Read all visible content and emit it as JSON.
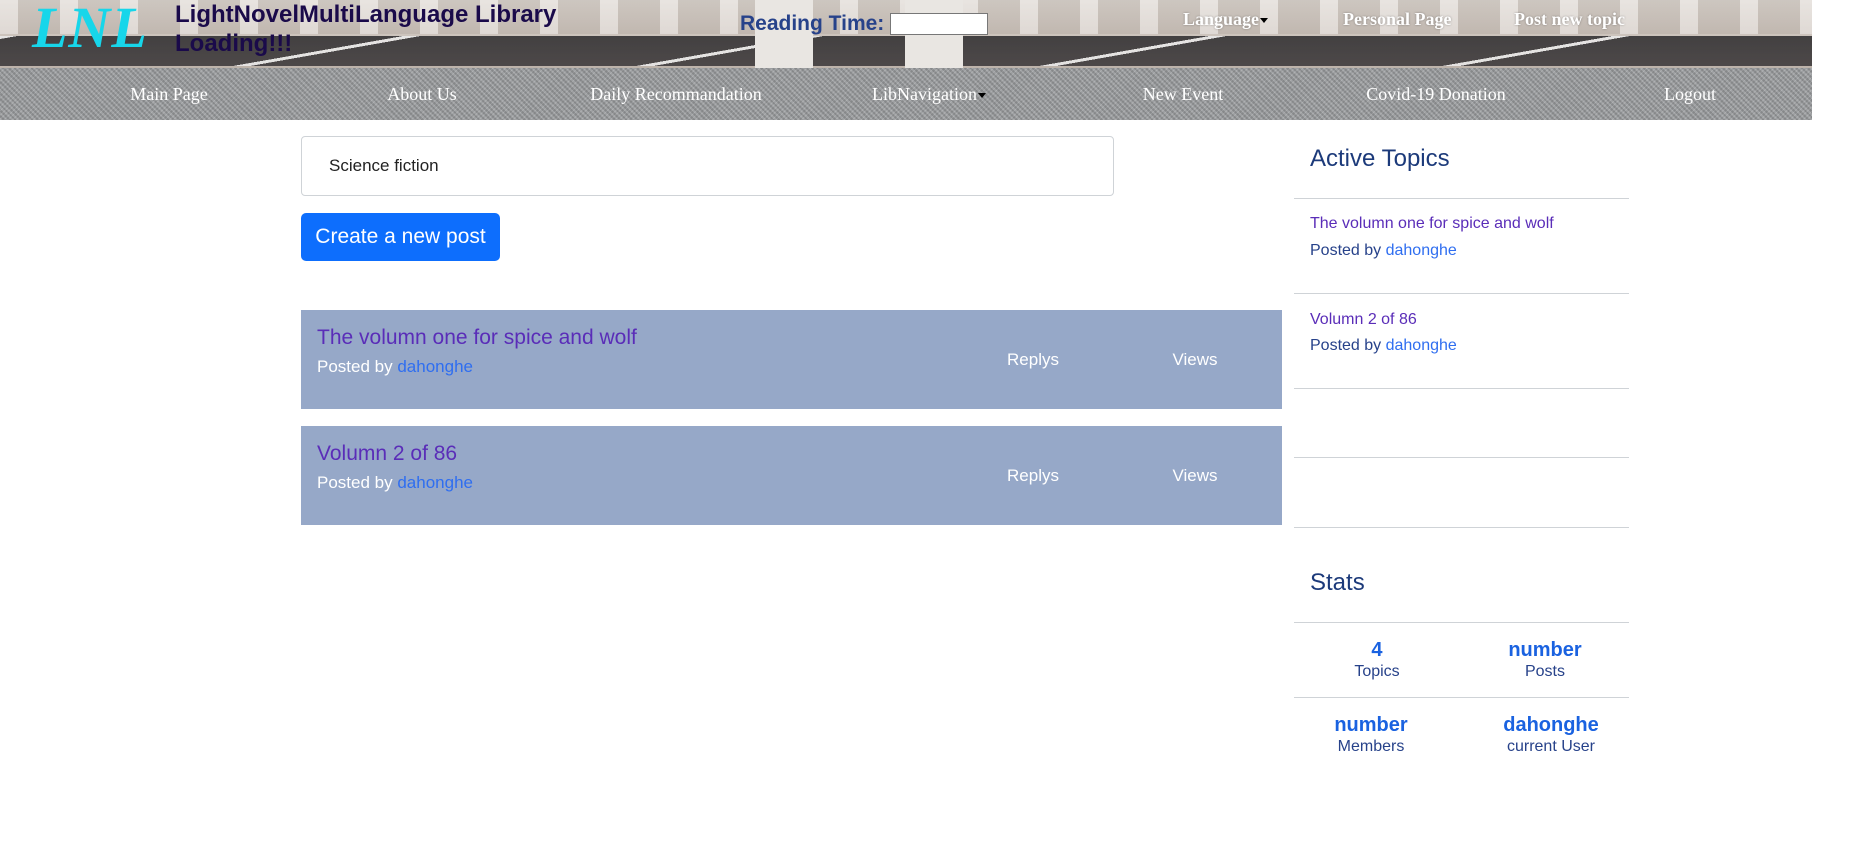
{
  "header": {
    "logo": "LNL",
    "title": "LightNovelMultiLanguage Library Loading!!!",
    "reading_label": "Reading Time:",
    "reading_value": "",
    "language": "Language",
    "personal_page": "Personal Page",
    "post_new_topic": "Post new topic"
  },
  "nav": {
    "items": [
      {
        "label": "Main Page"
      },
      {
        "label": "About Us"
      },
      {
        "label": "Daily Recommandation"
      },
      {
        "label": "LibNavigation"
      },
      {
        "label": "New Event"
      },
      {
        "label": "Covid-19 Donation"
      },
      {
        "label": "Logout"
      }
    ]
  },
  "main": {
    "category": "Science fiction",
    "create_button": "Create a new post",
    "topics": [
      {
        "title": "The volumn one for spice and wolf",
        "posted_by": "Posted by",
        "author": "dahonghe",
        "replys": "Replys",
        "views": "Views"
      },
      {
        "title": "Volumn 2 of 86",
        "posted_by": "Posted by",
        "author": "dahonghe",
        "replys": "Replys",
        "views": "Views"
      }
    ]
  },
  "sidebar": {
    "active_heading": "Active Topics",
    "active_topics": [
      {
        "title": "The volumn one for spice and wolf",
        "posted_by": "Posted by",
        "author": "dahonghe"
      },
      {
        "title": "Volumn 2 of 86",
        "posted_by": "Posted by",
        "author": "dahonghe"
      }
    ],
    "stats_heading": "Stats",
    "stats": [
      {
        "value": "4",
        "label": "Topics"
      },
      {
        "value": "number",
        "label": "Posts"
      },
      {
        "value": "number",
        "label": "Members"
      },
      {
        "value": "dahonghe",
        "label": "current User"
      }
    ]
  },
  "colors": {
    "logo": "#17d6ea",
    "primary_button": "#0d6efd",
    "topic_row_bg": "#96a8c8",
    "topic_title": "#5a2db8",
    "link": "#2f6ef0",
    "heading": "#1c3a7a"
  }
}
